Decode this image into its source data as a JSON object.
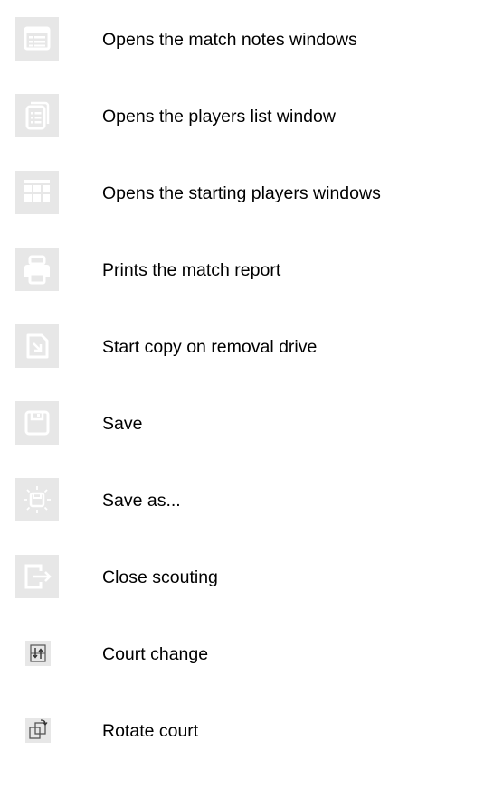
{
  "items": [
    {
      "icon": "match-notes-icon",
      "label": "Opens the match notes windows"
    },
    {
      "icon": "players-list-icon",
      "label": "Opens the players list window"
    },
    {
      "icon": "starting-players-grid-icon",
      "label": "Opens the starting players windows"
    },
    {
      "icon": "printer-icon",
      "label": "Prints the match report"
    },
    {
      "icon": "copy-to-drive-icon",
      "label": "Start copy on removal drive"
    },
    {
      "icon": "save-icon",
      "label": "Save"
    },
    {
      "icon": "save-as-icon",
      "label": "Save as..."
    },
    {
      "icon": "close-scouting-icon",
      "label": "Close scouting"
    },
    {
      "icon": "court-change-icon",
      "label": "Court change"
    },
    {
      "icon": "rotate-court-icon",
      "label": "Rotate court"
    }
  ]
}
